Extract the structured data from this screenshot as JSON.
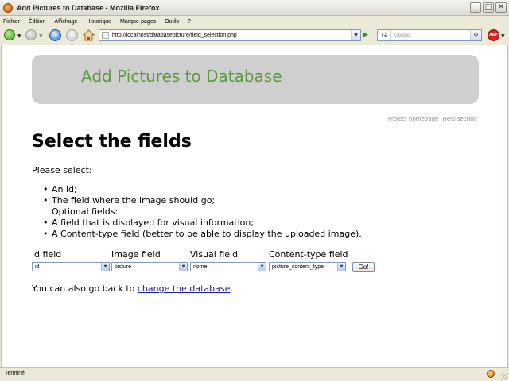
{
  "window": {
    "title": "Add Pictures to Database - Mozilla Firefox",
    "buttons": {
      "minimize": "_",
      "maximize": "□",
      "close": "✕"
    }
  },
  "menu": {
    "items": [
      "Fichier",
      "Édition",
      "Affichage",
      "Historique",
      "Marque-pages",
      "Outils",
      "?"
    ]
  },
  "toolbar": {
    "url": "http://localhost/databasepicture/field_selection.php",
    "search_placeholder": "Google",
    "search_engine_glyph": "G",
    "adblock_label": "ABP"
  },
  "page": {
    "banner_title": "Add Pictures to Database",
    "links": {
      "project_homepage": "Project homepage",
      "help_section": "Help section"
    },
    "heading": "Select the fields",
    "intro": "Please select:",
    "requirements": [
      "An id;",
      "The field where the image should go;",
      "Optional fields:",
      "A field that is displayed for visual information;",
      "A Content-type field (better to be able to display the uploaded image)."
    ],
    "fields": [
      {
        "label": "id field",
        "value": "id"
      },
      {
        "label": "Image field",
        "value": "picture"
      },
      {
        "label": "Visual field",
        "value": "nome"
      },
      {
        "label": "Content-type field",
        "value": "picture_content_type"
      }
    ],
    "go_button": "Go!",
    "back_prefix": "You can also go back to ",
    "back_link": "change the database",
    "back_suffix": "."
  },
  "status": {
    "text": "Terminé"
  },
  "colors": {
    "banner_bg": "#cfcfcf",
    "banner_title": "#5a9a3c",
    "link": "#1a1aa8"
  }
}
